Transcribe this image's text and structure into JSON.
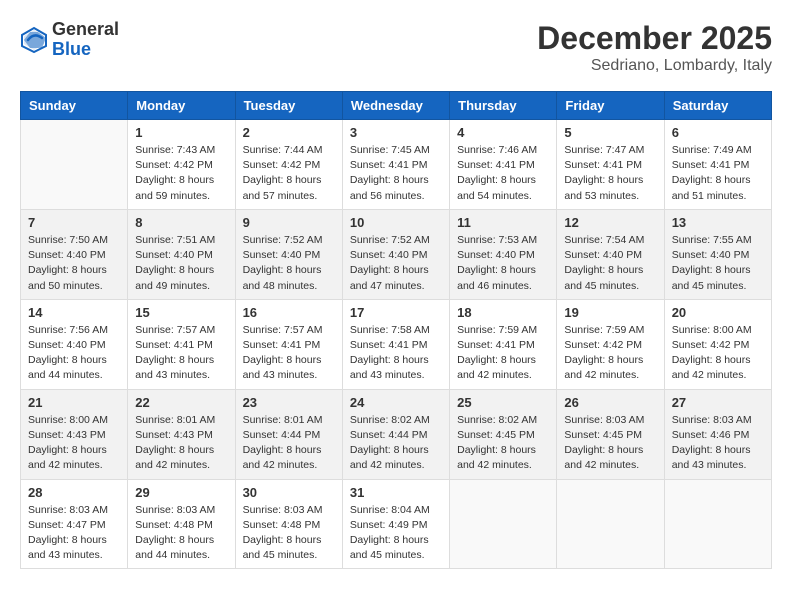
{
  "header": {
    "logo_general": "General",
    "logo_blue": "Blue",
    "month_title": "December 2025",
    "location": "Sedriano, Lombardy, Italy"
  },
  "weekdays": [
    "Sunday",
    "Monday",
    "Tuesday",
    "Wednesday",
    "Thursday",
    "Friday",
    "Saturday"
  ],
  "weeks": [
    [
      {
        "day": "",
        "info": ""
      },
      {
        "day": "1",
        "info": "Sunrise: 7:43 AM\nSunset: 4:42 PM\nDaylight: 8 hours\nand 59 minutes."
      },
      {
        "day": "2",
        "info": "Sunrise: 7:44 AM\nSunset: 4:42 PM\nDaylight: 8 hours\nand 57 minutes."
      },
      {
        "day": "3",
        "info": "Sunrise: 7:45 AM\nSunset: 4:41 PM\nDaylight: 8 hours\nand 56 minutes."
      },
      {
        "day": "4",
        "info": "Sunrise: 7:46 AM\nSunset: 4:41 PM\nDaylight: 8 hours\nand 54 minutes."
      },
      {
        "day": "5",
        "info": "Sunrise: 7:47 AM\nSunset: 4:41 PM\nDaylight: 8 hours\nand 53 minutes."
      },
      {
        "day": "6",
        "info": "Sunrise: 7:49 AM\nSunset: 4:41 PM\nDaylight: 8 hours\nand 51 minutes."
      }
    ],
    [
      {
        "day": "7",
        "info": "Sunrise: 7:50 AM\nSunset: 4:40 PM\nDaylight: 8 hours\nand 50 minutes."
      },
      {
        "day": "8",
        "info": "Sunrise: 7:51 AM\nSunset: 4:40 PM\nDaylight: 8 hours\nand 49 minutes."
      },
      {
        "day": "9",
        "info": "Sunrise: 7:52 AM\nSunset: 4:40 PM\nDaylight: 8 hours\nand 48 minutes."
      },
      {
        "day": "10",
        "info": "Sunrise: 7:52 AM\nSunset: 4:40 PM\nDaylight: 8 hours\nand 47 minutes."
      },
      {
        "day": "11",
        "info": "Sunrise: 7:53 AM\nSunset: 4:40 PM\nDaylight: 8 hours\nand 46 minutes."
      },
      {
        "day": "12",
        "info": "Sunrise: 7:54 AM\nSunset: 4:40 PM\nDaylight: 8 hours\nand 45 minutes."
      },
      {
        "day": "13",
        "info": "Sunrise: 7:55 AM\nSunset: 4:40 PM\nDaylight: 8 hours\nand 45 minutes."
      }
    ],
    [
      {
        "day": "14",
        "info": "Sunrise: 7:56 AM\nSunset: 4:40 PM\nDaylight: 8 hours\nand 44 minutes."
      },
      {
        "day": "15",
        "info": "Sunrise: 7:57 AM\nSunset: 4:41 PM\nDaylight: 8 hours\nand 43 minutes."
      },
      {
        "day": "16",
        "info": "Sunrise: 7:57 AM\nSunset: 4:41 PM\nDaylight: 8 hours\nand 43 minutes."
      },
      {
        "day": "17",
        "info": "Sunrise: 7:58 AM\nSunset: 4:41 PM\nDaylight: 8 hours\nand 43 minutes."
      },
      {
        "day": "18",
        "info": "Sunrise: 7:59 AM\nSunset: 4:41 PM\nDaylight: 8 hours\nand 42 minutes."
      },
      {
        "day": "19",
        "info": "Sunrise: 7:59 AM\nSunset: 4:42 PM\nDaylight: 8 hours\nand 42 minutes."
      },
      {
        "day": "20",
        "info": "Sunrise: 8:00 AM\nSunset: 4:42 PM\nDaylight: 8 hours\nand 42 minutes."
      }
    ],
    [
      {
        "day": "21",
        "info": "Sunrise: 8:00 AM\nSunset: 4:43 PM\nDaylight: 8 hours\nand 42 minutes."
      },
      {
        "day": "22",
        "info": "Sunrise: 8:01 AM\nSunset: 4:43 PM\nDaylight: 8 hours\nand 42 minutes."
      },
      {
        "day": "23",
        "info": "Sunrise: 8:01 AM\nSunset: 4:44 PM\nDaylight: 8 hours\nand 42 minutes."
      },
      {
        "day": "24",
        "info": "Sunrise: 8:02 AM\nSunset: 4:44 PM\nDaylight: 8 hours\nand 42 minutes."
      },
      {
        "day": "25",
        "info": "Sunrise: 8:02 AM\nSunset: 4:45 PM\nDaylight: 8 hours\nand 42 minutes."
      },
      {
        "day": "26",
        "info": "Sunrise: 8:03 AM\nSunset: 4:45 PM\nDaylight: 8 hours\nand 42 minutes."
      },
      {
        "day": "27",
        "info": "Sunrise: 8:03 AM\nSunset: 4:46 PM\nDaylight: 8 hours\nand 43 minutes."
      }
    ],
    [
      {
        "day": "28",
        "info": "Sunrise: 8:03 AM\nSunset: 4:47 PM\nDaylight: 8 hours\nand 43 minutes."
      },
      {
        "day": "29",
        "info": "Sunrise: 8:03 AM\nSunset: 4:48 PM\nDaylight: 8 hours\nand 44 minutes."
      },
      {
        "day": "30",
        "info": "Sunrise: 8:03 AM\nSunset: 4:48 PM\nDaylight: 8 hours\nand 45 minutes."
      },
      {
        "day": "31",
        "info": "Sunrise: 8:04 AM\nSunset: 4:49 PM\nDaylight: 8 hours\nand 45 minutes."
      },
      {
        "day": "",
        "info": ""
      },
      {
        "day": "",
        "info": ""
      },
      {
        "day": "",
        "info": ""
      }
    ]
  ]
}
